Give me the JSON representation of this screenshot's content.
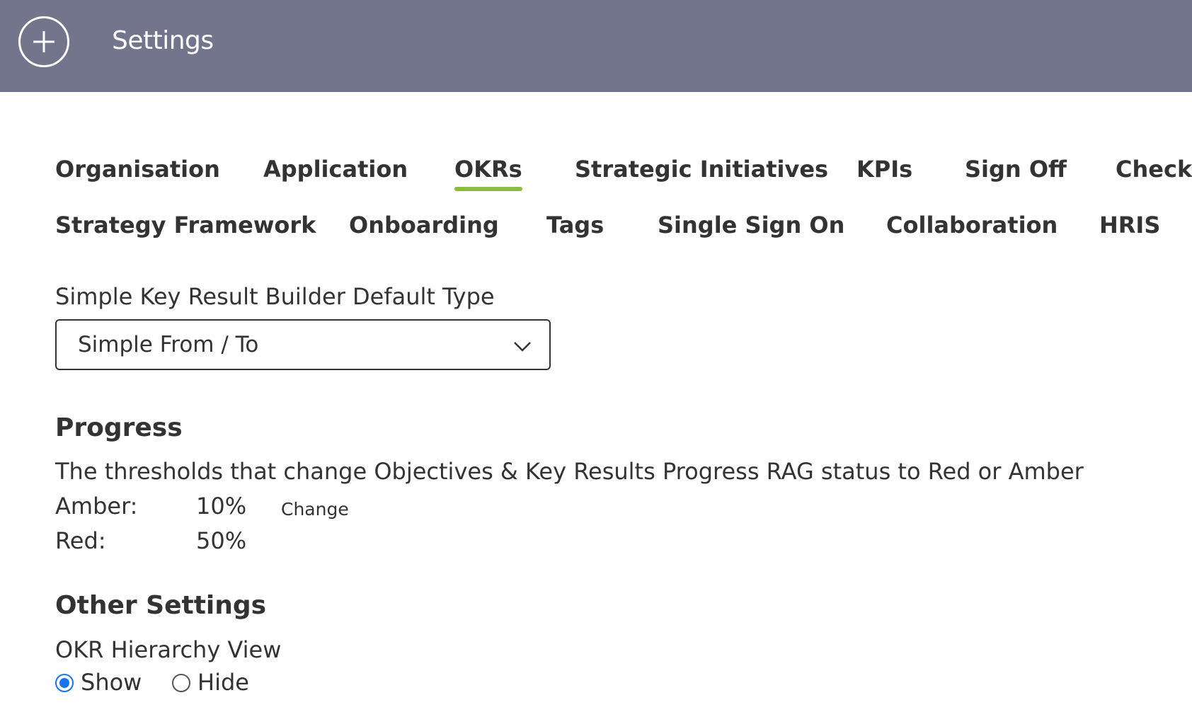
{
  "header": {
    "add_icon": "plus-circle-icon",
    "title": "Settings"
  },
  "tabs_row1": [
    {
      "label": "Organisation",
      "active": false
    },
    {
      "label": "Application",
      "active": false
    },
    {
      "label": "OKRs",
      "active": true
    },
    {
      "label": "Strategic Initiatives",
      "active": false
    },
    {
      "label": "KPIs",
      "active": false
    },
    {
      "label": "Sign Off",
      "active": false
    },
    {
      "label": "Check-",
      "active": false
    }
  ],
  "tabs_row2": [
    {
      "label": "Strategy Framework",
      "active": false
    },
    {
      "label": "Onboarding",
      "active": false
    },
    {
      "label": "Tags",
      "active": false
    },
    {
      "label": "Single Sign On",
      "active": false
    },
    {
      "label": "Collaboration",
      "active": false
    },
    {
      "label": "HRIS",
      "active": false
    }
  ],
  "builder": {
    "label": "Simple Key Result Builder Default Type",
    "selected": "Simple From / To",
    "dropdown_icon": "chevron-down-icon"
  },
  "progress": {
    "title": "Progress",
    "description": "The thresholds that change Objectives & Key Results Progress RAG status to Red or Amber",
    "amber_label": "Amber:",
    "amber_value": "10%",
    "red_label": "Red:",
    "red_value": "50%",
    "change_label": "Change"
  },
  "other_settings": {
    "title": "Other Settings",
    "hierarchy_label": "OKR Hierarchy View",
    "options": [
      {
        "label": "Show",
        "selected": true
      },
      {
        "label": "Hide",
        "selected": false
      }
    ]
  },
  "colors": {
    "topbar": "#72758b",
    "active_tab_underline": "#8dbb3d",
    "radio_accent": "#1a73e8"
  }
}
